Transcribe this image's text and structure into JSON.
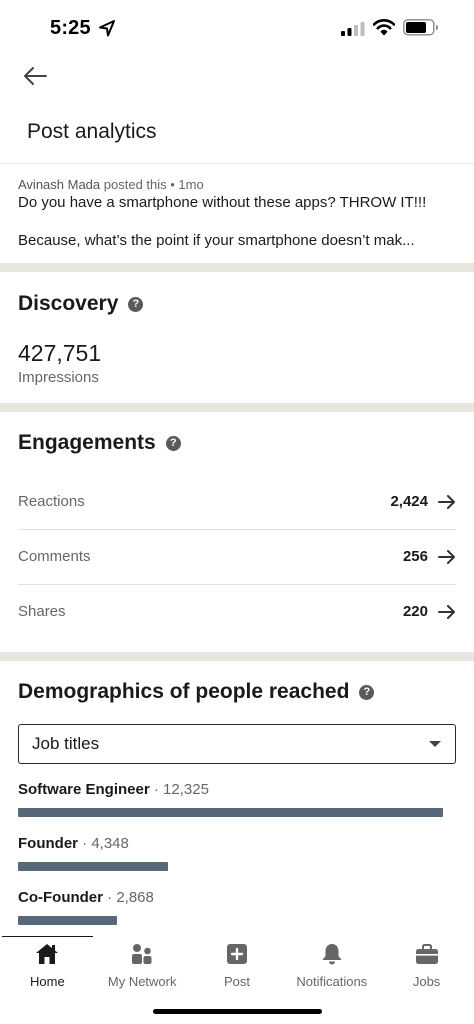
{
  "status_bar": {
    "time": "5:25"
  },
  "header": {
    "title": "Post analytics"
  },
  "post": {
    "author": "Avinash Mada",
    "meta_suffix": "posted this • 1mo",
    "line1": "Do you have a smartphone without these apps? THROW IT!!!",
    "line2": "Because, what’s the point if your smartphone doesn’t mak..."
  },
  "discovery": {
    "heading": "Discovery",
    "impressions_value": "427,751",
    "impressions_label": "Impressions"
  },
  "engagements": {
    "heading": "Engagements",
    "rows": [
      {
        "label": "Reactions",
        "value": "2,424"
      },
      {
        "label": "Comments",
        "value": "256"
      },
      {
        "label": "Shares",
        "value": "220"
      }
    ]
  },
  "demographics": {
    "heading": "Demographics of people reached",
    "selected_filter": "Job titles",
    "items": [
      {
        "name": "Software Engineer",
        "count": "· 12,325",
        "fraction": 1.0
      },
      {
        "name": "Founder",
        "count": "· 4,348",
        "fraction": 0.353
      },
      {
        "name": "Co-Founder",
        "count": "· 2,868",
        "fraction": 0.233
      }
    ]
  },
  "bottom_nav": {
    "items": [
      {
        "label": "Home",
        "icon": "home-icon",
        "active": true
      },
      {
        "label": "My Network",
        "icon": "network-icon",
        "active": false
      },
      {
        "label": "Post",
        "icon": "post-icon",
        "active": false
      },
      {
        "label": "Notifications",
        "icon": "bell-icon",
        "active": false
      },
      {
        "label": "Jobs",
        "icon": "briefcase-icon",
        "active": false
      }
    ]
  },
  "colors": {
    "bar": "#56687a",
    "section_separator": "#e9e5df"
  }
}
